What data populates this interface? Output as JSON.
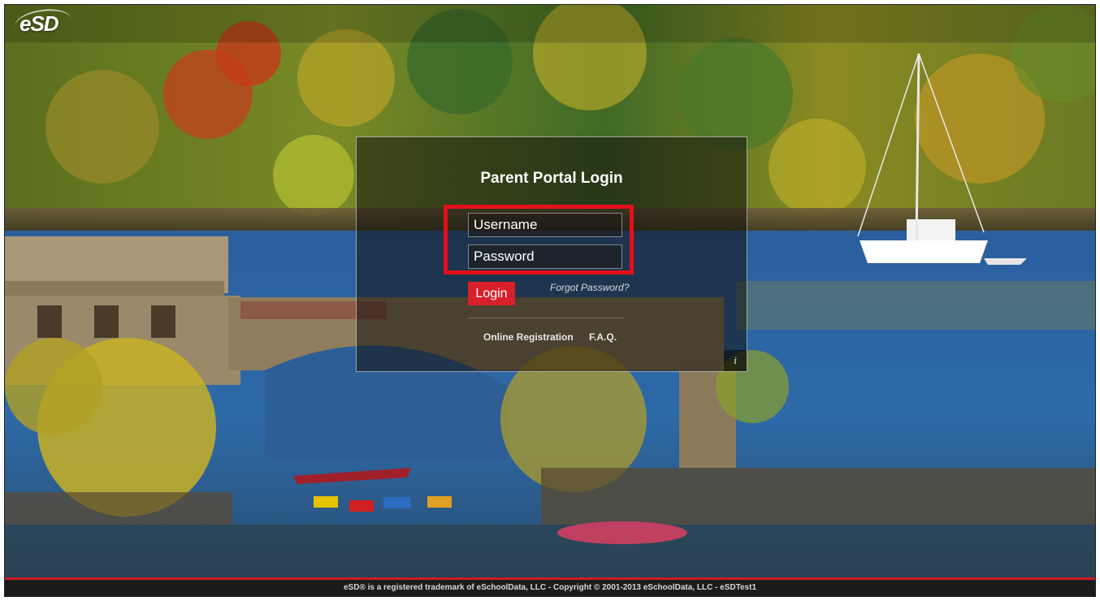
{
  "header": {
    "logo_text": "eSD"
  },
  "login": {
    "title": "Parent Portal Login",
    "username_placeholder": "Username",
    "password_placeholder": "Password",
    "username_value": "",
    "password_value": "",
    "login_label": "Login",
    "forgot_password_label": "Forgot Password?",
    "links": [
      {
        "label": "Online Registration"
      },
      {
        "label": "F.A.Q."
      }
    ],
    "info_label": "i"
  },
  "footer": {
    "text": "eSD® is a registered trademark of eSchoolData, LLC - Copyright © 2001-2013 eSchoolData, LLC - eSDTest1"
  },
  "colors": {
    "accent_red": "#d8202a",
    "highlight_red": "#e3101a",
    "footer_bar": "#1b1b1b"
  },
  "icons": {
    "info": "info-icon"
  }
}
